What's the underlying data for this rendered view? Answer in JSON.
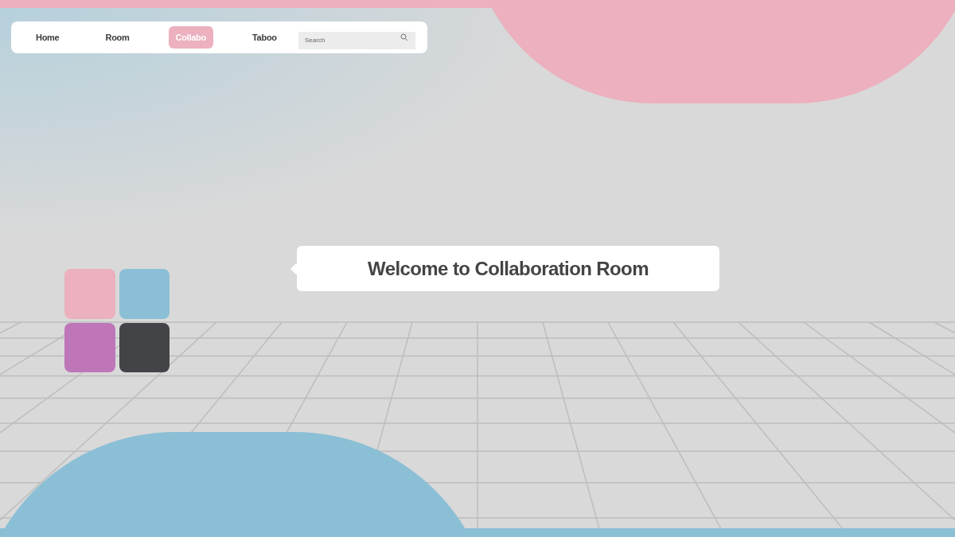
{
  "nav": {
    "items": [
      {
        "label": "Home",
        "selected": false
      },
      {
        "label": "Room",
        "selected": false
      },
      {
        "label": "Collabo",
        "selected": true
      },
      {
        "label": "Taboo",
        "selected": false
      }
    ],
    "search": {
      "placeholder": "Search"
    }
  },
  "welcome": {
    "message": "Welcome to Collaboration Room"
  },
  "tiles": [
    {
      "color": "#ecb0be"
    },
    {
      "color": "#8bbfd6"
    },
    {
      "color": "#bf76b9"
    },
    {
      "color": "#434447"
    }
  ]
}
